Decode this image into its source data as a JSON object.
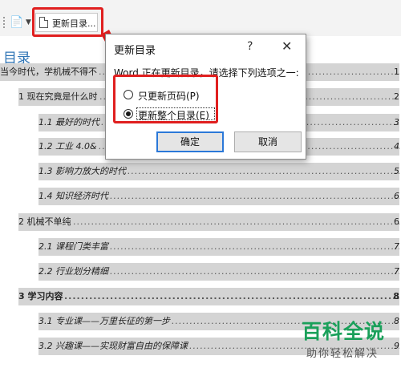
{
  "toolbar": {
    "update_toc_label": "更新目录...",
    "doc_icon": "document-icon",
    "caret_icon": "chevron-down-icon"
  },
  "document": {
    "toc_heading": "目录",
    "lines": [
      {
        "text": "当今时代，学机械不得不",
        "page": "1"
      },
      {
        "text": "1 现在究竟是什么时",
        "page": "2"
      },
      {
        "text": "1.1 最好的时代",
        "page": "3"
      },
      {
        "text": "1.2 工业 4.0&",
        "page": "4"
      },
      {
        "text": "1.3 影响力放大的时代",
        "page": "5"
      },
      {
        "text": "1.4 知识经济时代",
        "page": "6"
      },
      {
        "text": "2 机械不单纯",
        "page": "6"
      },
      {
        "text": "2.1 课程门类丰富",
        "page": "7"
      },
      {
        "text": "2.2 行业划分精细",
        "page": "7"
      },
      {
        "text": "3 学习内容",
        "page": "8"
      },
      {
        "text": "3.1 专业课——万里长征的第一步",
        "page": "8"
      },
      {
        "text": "3.2 兴趣课——实现财富自由的保障课",
        "page": "9"
      }
    ]
  },
  "dialog": {
    "title": "更新目录",
    "help": "?",
    "close": "✕",
    "message": "Word 正在更新目录，请选择下列选项之一:",
    "option1": "只更新页码(P)",
    "option2": "更新整个目录(E)",
    "selected_option": "更新整个目录(E)",
    "ok_label": "确定",
    "cancel_label": "取消"
  },
  "watermark": {
    "title": "百科全说",
    "subtitle": "助你轻松解决"
  },
  "colors": {
    "highlight_red": "#e01f1f",
    "toc_shading": "#d4d4d4",
    "heading_blue": "#2e74b5",
    "watermark_green": "#1aa05a"
  }
}
